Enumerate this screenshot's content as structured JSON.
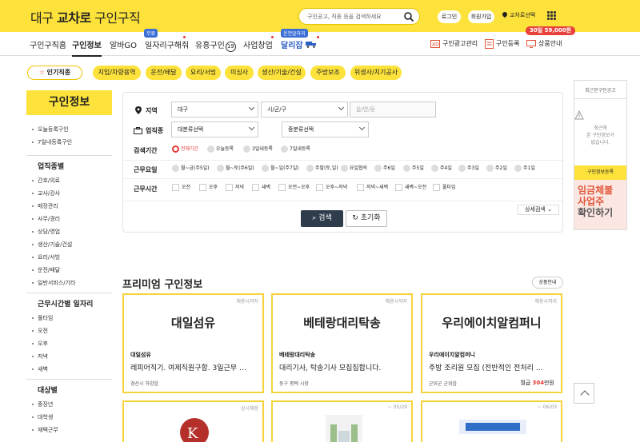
{
  "header": {
    "logo_pre": "대구 ",
    "logo_bold": "교차로",
    "logo_post": " 구인구직",
    "search_placeholder": "구인공고, 직종 등을 검색하세요",
    "login": "로그인",
    "signup": "회원가입",
    "location": "교차로선택",
    "brand_color": "#fde23b"
  },
  "nav": {
    "items": [
      "구인구직홈",
      "구인정보",
      "알바GO",
      "일자리구해줘",
      "유흥구인",
      "사업창업",
      "달리잡"
    ],
    "active": "구인정보",
    "free_tag": "무료",
    "driver_tag": "운전알자리",
    "adult_badge": "19",
    "right": [
      "구인광고관리",
      "구인등록",
      "상품안내"
    ],
    "promo": "30일 59,000원"
  },
  "chips": [
    "인기직종",
    "지입/차량용역",
    "운전/배달",
    "요리/서빙",
    "미싱사",
    "생산/기술/건설",
    "주방보조",
    "위생사/치기공사"
  ],
  "sidebar": {
    "title": "구인정보",
    "quick": [
      "오늘등록구인",
      "7일내등록구인"
    ],
    "groups": [
      {
        "title": "업직종별",
        "items": [
          "간호/의료",
          "교사/강사",
          "매장관리",
          "사무/경리",
          "상담/영업",
          "생산/기술/건설",
          "요리/서빙",
          "운전/배달",
          "일반서비스/기타"
        ]
      },
      {
        "title": "근무시간별 일자리",
        "items": [
          "풀타임",
          "오전",
          "오후",
          "저녁",
          "새벽"
        ]
      },
      {
        "title": "대상별",
        "items": [
          "중장년",
          "대학생",
          "재택근무"
        ]
      }
    ]
  },
  "filter": {
    "region_label": "지역",
    "region": [
      "대구",
      "시/군/구",
      "읍/면/동"
    ],
    "job_label": "업직종",
    "job": [
      "대분류선택",
      "중분류선택"
    ],
    "period_label": "검색기간",
    "period": [
      "전체기간",
      "오늘등록",
      "3일내등록",
      "7일내등록"
    ],
    "days_label": "근무요일",
    "days": [
      "월~금(주5일)",
      "월~토(주6일)",
      "월~일(주7일)",
      "주말(토,일)",
      "요일협의",
      "주6일",
      "주5일",
      "주4일",
      "주3일",
      "주2일",
      "주1일"
    ],
    "hours_label": "근무시간",
    "hours": [
      "오전",
      "오후",
      "저녁",
      "새벽",
      "오전~오후",
      "오후~저녁",
      "저녁~새벽",
      "새벽~오전",
      "풀타임"
    ],
    "search_btn": "검색",
    "reset_btn": "초기화",
    "detail_btn": "상세검색"
  },
  "side_ad": {
    "title": "최근본구인공고",
    "empty_msg": [
      "최근에",
      "본 구인정보가",
      "없습니다."
    ],
    "register_btn": "구인정보등록",
    "banner": [
      "임금체불",
      "사업주",
      "확인하기"
    ]
  },
  "premium": {
    "title": "프리미엄 구인정보",
    "info_btn": "상품안내",
    "cards": [
      {
        "due": "채용시까지",
        "logo": "대일섬유",
        "name": "대일섬유",
        "desc": "레피어직기. 여제직원구함. 3일근무 …",
        "loc": "경산시 하양읍",
        "pay_label": "",
        "pay_amount": "",
        "pay_unit": ""
      },
      {
        "due": "채용시까지",
        "logo": "베테랑대리탁송",
        "name": "베테랑대리탁송",
        "desc": "대리기사, 탁송기사 모집집합니다.",
        "loc": "동구 평택 시장",
        "pay_label": "",
        "pay_amount": "",
        "pay_unit": ""
      },
      {
        "due": "채용시까지",
        "logo": "우리에이치알컴퍼니",
        "name": "우리에이치알컴퍼니",
        "desc": "주방 조리원 모집 (전반적인 전처리 …",
        "loc": "군위군 군위읍",
        "pay_label": "월급",
        "pay_amount": "304",
        "pay_unit": "만원"
      }
    ],
    "row2": [
      {
        "due": "상시채용"
      },
      {
        "due": "~ 05/29"
      },
      {
        "due": "~ 06/03"
      }
    ]
  }
}
